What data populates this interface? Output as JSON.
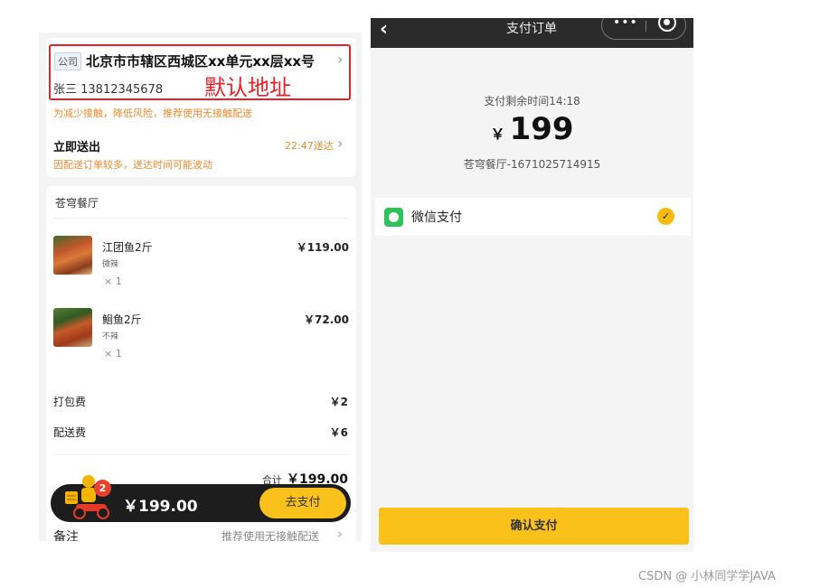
{
  "checkout": {
    "address": {
      "tag": "公司",
      "text": "北京市市辖区西城区xx单元xx层xx号",
      "person": "张三 13812345678",
      "default_label": "默认地址",
      "tip": "为减少接触，降低风险，推荐使用无接触配送"
    },
    "delivery": {
      "title": "立即送出",
      "time": "22:47送达",
      "tip": "因配送订单较多，送达时间可能波动"
    },
    "shop_name": "苍穹餐厅",
    "dishes": [
      {
        "name": "江团鱼2斤",
        "spec": "微辣",
        "qty": "× 1",
        "price": "￥119.00"
      },
      {
        "name": "鮰鱼2斤",
        "spec": "不辣",
        "qty": "× 1",
        "price": "￥72.00"
      }
    ],
    "fees": [
      {
        "label": "打包费",
        "value": "￥2"
      },
      {
        "label": "配送费",
        "value": "￥6"
      }
    ],
    "total_label": "合计",
    "total_value": "￥199.00",
    "remark_label": "备注",
    "remark_hint": "推荐使用无接触配送",
    "cart": {
      "badge": "2",
      "total": "￥199.00",
      "pay_button": "去支付"
    }
  },
  "payment": {
    "nav_title": "支付订单",
    "countdown": "支付剩余时间14:18",
    "currency": "￥",
    "amount": "199",
    "order_no": "苍穹餐厅-1671025714915",
    "method": "微信支付",
    "check_mark": "✓",
    "confirm_button": "确认支付",
    "capsule_dots": "•••"
  },
  "watermark": "CSDN @ 小林同学学JAVA",
  "colors": {
    "accent_yellow": "#f9c11a",
    "highlight_red": "#e8202a",
    "tip_orange": "#f08a2c",
    "wechat_green": "#2fc25b"
  },
  "icons": [
    "chevron-right-icon",
    "back-icon",
    "more-icon",
    "close-capsule-icon",
    "wechat-pay-icon",
    "check-icon",
    "delivery-rider-icon"
  ]
}
